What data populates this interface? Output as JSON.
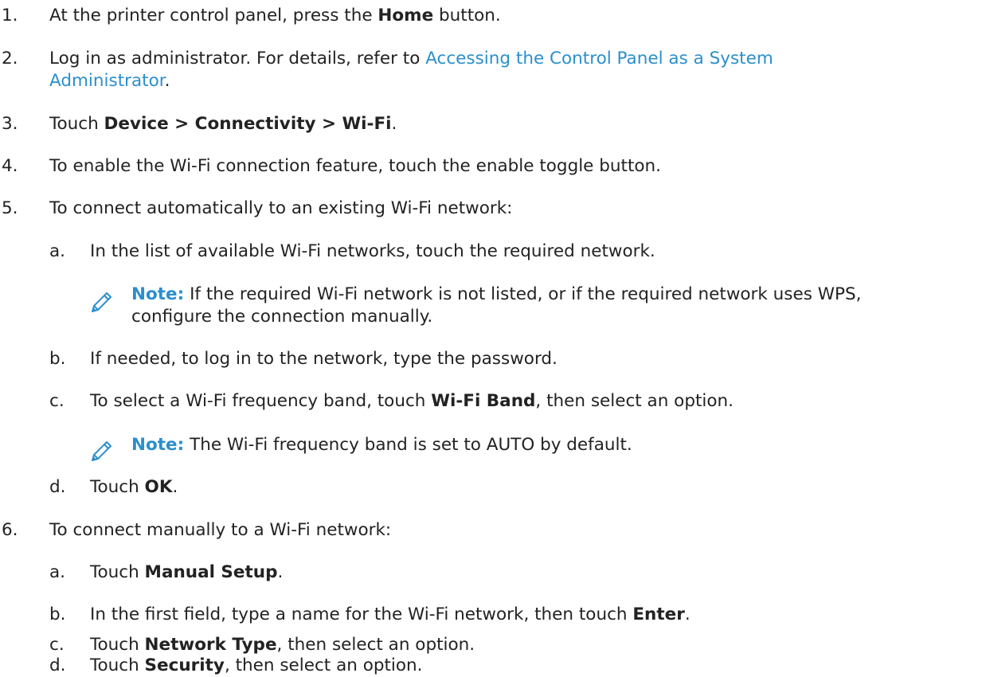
{
  "steps": [
    {
      "num": "1.",
      "pre": "At the printer control panel, press the ",
      "bold": "Home",
      "post": " button."
    },
    {
      "num": "2.",
      "pre": "Log in as administrator. For details, refer to ",
      "link_line1": "Accessing the Control Panel as a System",
      "link_line2": "Administrator",
      "post": "."
    },
    {
      "num": "3.",
      "pre": "Touch ",
      "bold": "Device > Connectivity > Wi-Fi",
      "post": "."
    },
    {
      "num": "4.",
      "text": "To enable the Wi-Fi connection feature, touch the enable toggle button."
    },
    {
      "num": "5.",
      "text": "To connect automatically to an existing Wi-Fi network:",
      "substeps": [
        {
          "letter": "a.",
          "text": "In the list of available Wi-Fi networks, touch the required network."
        },
        {
          "letter": "b.",
          "text": "If needed, to log in to the network, type the password."
        },
        {
          "letter": "c.",
          "pre": "To select a Wi-Fi frequency band, touch ",
          "bold": "Wi-Fi Band",
          "post": ", then select an option."
        },
        {
          "letter": "d.",
          "pre": "Touch ",
          "bold": "OK",
          "post": "."
        }
      ]
    },
    {
      "num": "6.",
      "text": "To connect manually to a Wi-Fi network:",
      "substeps": [
        {
          "letter": "a.",
          "pre": "Touch ",
          "bold": "Manual Setup",
          "post": "."
        },
        {
          "letter": "b.",
          "pre": "In the first field, type a name for the Wi-Fi network, then touch ",
          "bold": "Enter",
          "post": "."
        },
        {
          "letter": "c.",
          "pre": "Touch ",
          "bold": "Network Type",
          "post": ", then select an option."
        },
        {
          "letter": "d.",
          "pre": "Touch ",
          "bold": "Security",
          "post": ", then select an option."
        }
      ]
    }
  ],
  "notes": [
    {
      "label": "Note:",
      "line1": " If the required Wi-Fi network is not listed, or if the required network uses WPS,",
      "line2": "configure the connection manually."
    },
    {
      "label": "Note:",
      "line1": " The Wi-Fi frequency band is set to AUTO by default."
    }
  ],
  "icons": {
    "note": "pencil-note-icon"
  },
  "colors": {
    "link": "#2b8fcc",
    "text": "#222222"
  }
}
